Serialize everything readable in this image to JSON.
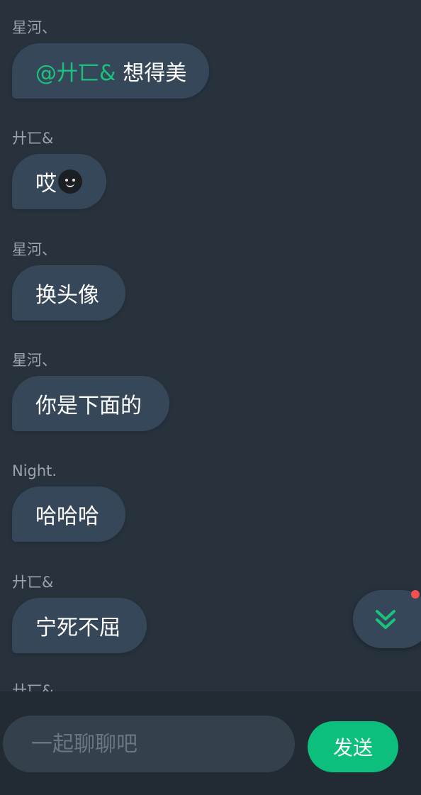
{
  "messages": [
    {
      "sender": "星河、",
      "mention": "@廾匸&",
      "text": "想得美"
    },
    {
      "sender": "廾匸&",
      "text": "哎"
    },
    {
      "sender": "星河、",
      "text": "换头像"
    },
    {
      "sender": "星河、",
      "text": "你是下面的"
    },
    {
      "sender": "Night.",
      "text": "哈哈哈"
    },
    {
      "sender": "廾匸&",
      "text": "宁死不屈"
    },
    {
      "sender": "廾匸&"
    }
  ],
  "composer": {
    "placeholder": "一起聊聊吧",
    "send_label": "发送"
  },
  "icons": {
    "scroll_down": "double-chevron-down-icon",
    "emoji": "smiling-face-icon"
  },
  "colors": {
    "background": "#27323d",
    "bubble": "#37475a",
    "accent": "#0dbf7c",
    "mention": "#19c37d",
    "notify": "#f0524f"
  }
}
